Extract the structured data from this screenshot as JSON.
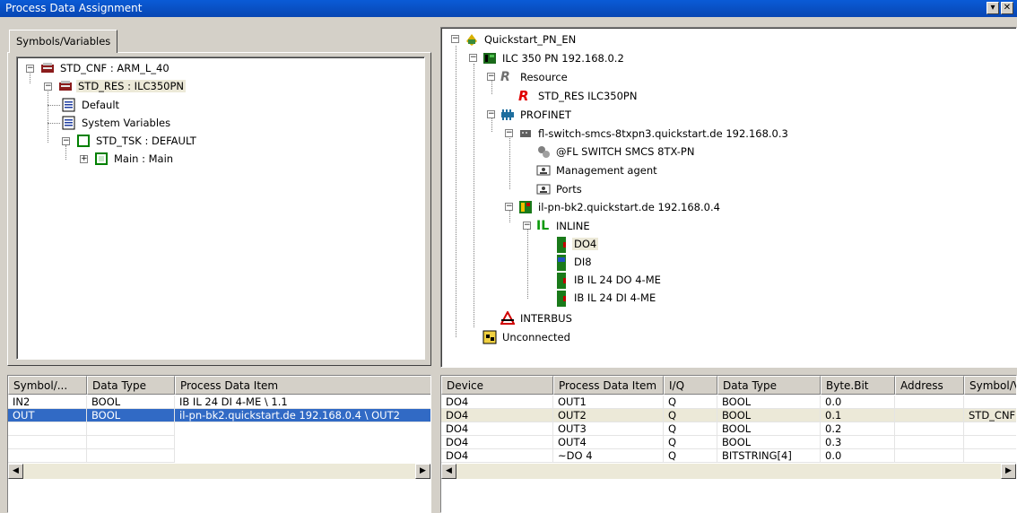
{
  "window": {
    "title": "Process Data Assignment",
    "title_bg": "#0a52cf"
  },
  "tab": {
    "label": "Symbols/Variables"
  },
  "symtree": [
    {
      "label": "STD_CNF : ARM_L_40",
      "icon": "cpu-config-icon"
    },
    {
      "label": "STD_RES : ILC350PN",
      "icon": "resource-icon"
    },
    {
      "label": "Default",
      "icon": "variable-list-icon"
    },
    {
      "label": "System Variables",
      "icon": "variable-list-icon"
    },
    {
      "label": "STD_TSK : DEFAULT",
      "icon": "task-icon"
    },
    {
      "label": "Main : Main",
      "icon": "program-icon"
    }
  ],
  "devtree": [
    {
      "label": "Quickstart_PN_EN",
      "icon": "project-icon"
    },
    {
      "label": "ILC 350 PN 192.168.0.2",
      "icon": "controller-icon"
    },
    {
      "label": "Resource",
      "icon": "resource-r-icon"
    },
    {
      "label": "STD_RES ILC350PN",
      "icon": "resource-r-red-icon"
    },
    {
      "label": "PROFINET",
      "icon": "profinet-icon"
    },
    {
      "label": "fl-switch-smcs-8txpn3.quickstart.de 192.168.0.3",
      "icon": "switch-icon"
    },
    {
      "label": "@FL SWITCH SMCS 8TX-PN",
      "icon": "switch-device-icon"
    },
    {
      "label": "Management agent",
      "icon": "agent-icon"
    },
    {
      "label": "Ports",
      "icon": "ports-icon"
    },
    {
      "label": "il-pn-bk2.quickstart.de 192.168.0.4",
      "icon": "bus-coupler-icon"
    },
    {
      "label": "INLINE",
      "icon": "inline-icon"
    },
    {
      "label": "DO4",
      "icon": "module-icon"
    },
    {
      "label": "DI8",
      "icon": "module-icon"
    },
    {
      "label": "IB IL 24 DO 4-ME",
      "icon": "module-icon"
    },
    {
      "label": "IB IL 24 DI 4-ME",
      "icon": "module-icon"
    },
    {
      "label": "INTERBUS",
      "icon": "interbus-icon"
    },
    {
      "label": "Unconnected",
      "icon": "unconnected-icon"
    }
  ],
  "left_grid": {
    "headers": [
      "Symbol/...",
      "Data Type",
      "Process Data Item"
    ],
    "rows": [
      [
        "IN2",
        "BOOL",
        "IB IL 24 DI 4-ME  \\ 1.1"
      ],
      [
        "OUT",
        "BOOL",
        "il-pn-bk2.quickstart.de 192.168.0.4  \\ OUT2"
      ]
    ]
  },
  "right_grid": {
    "headers": [
      "Device",
      "Process Data Item",
      "I/Q",
      "Data Type",
      "Byte.Bit",
      "Address",
      "Symbol/V"
    ],
    "rows": [
      [
        "DO4",
        "OUT1",
        "Q",
        "BOOL",
        "0.0",
        "",
        ""
      ],
      [
        "DO4",
        "OUT2",
        "Q",
        "BOOL",
        "0.1",
        "",
        "STD_CNF"
      ],
      [
        "DO4",
        "OUT3",
        "Q",
        "BOOL",
        "0.2",
        "",
        ""
      ],
      [
        "DO4",
        "OUT4",
        "Q",
        "BOOL",
        "0.3",
        "",
        ""
      ],
      [
        "DO4",
        "~DO 4",
        "Q",
        "BITSTRING[4]",
        "0.0",
        "",
        ""
      ]
    ]
  },
  "colors": {
    "selection": "#316ac5",
    "highlight": "#ece9d8",
    "face": "#d4d0c8"
  }
}
